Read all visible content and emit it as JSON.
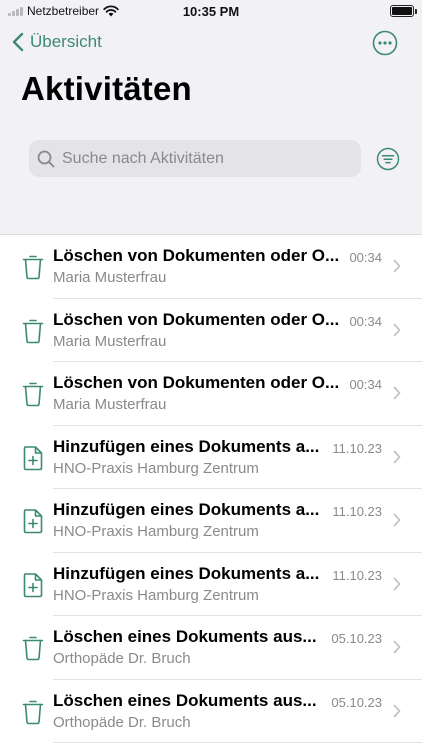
{
  "status_bar": {
    "carrier": "Netzbetreiber",
    "time": "10:35 PM"
  },
  "nav": {
    "back_label": "Übersicht"
  },
  "page": {
    "title": "Aktivitäten"
  },
  "search": {
    "placeholder": "Suche nach Aktivitäten"
  },
  "colors": {
    "accent": "#3d8a74",
    "header_bg": "#f2f1f6"
  },
  "activities": [
    {
      "icon": "trash-icon",
      "title": "Löschen von Dokumenten oder O...",
      "subtitle": "Maria Musterfrau",
      "time": "00:34"
    },
    {
      "icon": "trash-icon",
      "title": "Löschen von Dokumenten oder O...",
      "subtitle": "Maria Musterfrau",
      "time": "00:34"
    },
    {
      "icon": "trash-icon",
      "title": "Löschen von Dokumenten oder O...",
      "subtitle": "Maria Musterfrau",
      "time": "00:34"
    },
    {
      "icon": "document-add-icon",
      "title": "Hinzufügen eines Dokuments a...",
      "subtitle": "HNO-Praxis Hamburg Zentrum",
      "time": "11.10.23"
    },
    {
      "icon": "document-add-icon",
      "title": "Hinzufügen eines Dokuments a...",
      "subtitle": "HNO-Praxis Hamburg Zentrum",
      "time": "11.10.23"
    },
    {
      "icon": "document-add-icon",
      "title": "Hinzufügen eines Dokuments a...",
      "subtitle": "HNO-Praxis Hamburg Zentrum",
      "time": "11.10.23"
    },
    {
      "icon": "trash-icon",
      "title": "Löschen eines Dokuments aus...",
      "subtitle": "Orthopäde Dr. Bruch",
      "time": "05.10.23"
    },
    {
      "icon": "trash-icon",
      "title": "Löschen eines Dokuments aus...",
      "subtitle": "Orthopäde Dr. Bruch",
      "time": "05.10.23"
    }
  ]
}
